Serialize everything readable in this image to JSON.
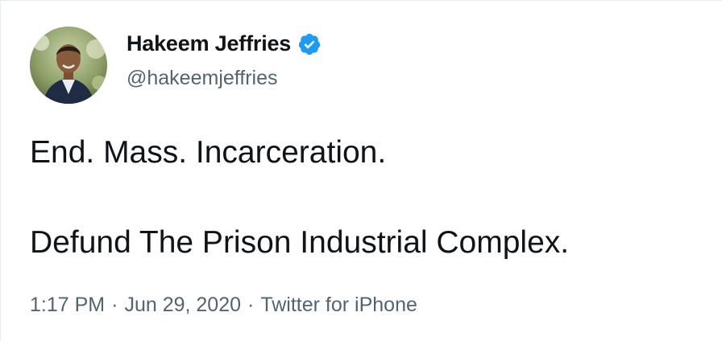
{
  "author": {
    "display_name": "Hakeem Jeffries",
    "handle": "@hakeemjeffries",
    "verified": true
  },
  "tweet": {
    "lines": [
      "End. Mass. Incarceration.",
      "Defund The Prison Industrial Complex."
    ]
  },
  "meta": {
    "time": "1:17 PM",
    "date": "Jun 29, 2020",
    "source": "Twitter for iPhone",
    "separator": "·"
  },
  "colors": {
    "text_primary": "#0f1419",
    "text_secondary": "#536471",
    "verified_blue": "#1d9bf0"
  },
  "icons": {
    "verified": "verified-badge-icon",
    "avatar": "profile-photo"
  }
}
